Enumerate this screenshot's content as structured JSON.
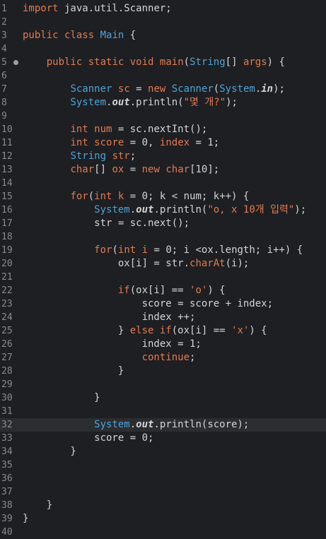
{
  "editor": {
    "language": "java",
    "current_line": 32,
    "lines": [
      {
        "n": "1",
        "tokens": [
          [
            "import",
            "kw"
          ],
          [
            " java.util.Scanner;",
            ""
          ]
        ]
      },
      {
        "n": "2",
        "tokens": []
      },
      {
        "n": "3",
        "tokens": [
          [
            "public",
            "kw"
          ],
          [
            " ",
            ""
          ],
          [
            "class",
            "kw"
          ],
          [
            " ",
            ""
          ],
          [
            "Main",
            "ty"
          ],
          [
            " {",
            ""
          ]
        ]
      },
      {
        "n": "4",
        "tokens": []
      },
      {
        "n": "5",
        "marker": true,
        "tokens": [
          [
            "    ",
            ""
          ],
          [
            "public",
            "kw"
          ],
          [
            " ",
            ""
          ],
          [
            "static",
            "kw"
          ],
          [
            " ",
            ""
          ],
          [
            "void",
            "kw"
          ],
          [
            " ",
            ""
          ],
          [
            "main",
            "kw"
          ],
          [
            "(",
            ""
          ],
          [
            "String",
            "ty"
          ],
          [
            "[] ",
            ""
          ],
          [
            "args",
            "kw"
          ],
          [
            ") {",
            ""
          ]
        ]
      },
      {
        "n": "6",
        "tokens": []
      },
      {
        "n": "7",
        "tokens": [
          [
            "        ",
            ""
          ],
          [
            "Scanner",
            "ty"
          ],
          [
            " ",
            ""
          ],
          [
            "sc",
            "kw"
          ],
          [
            " = ",
            ""
          ],
          [
            "new",
            "kw"
          ],
          [
            " ",
            ""
          ],
          [
            "Scanner",
            "ty"
          ],
          [
            "(",
            ""
          ],
          [
            "System",
            "ty"
          ],
          [
            ".",
            ""
          ],
          [
            "in",
            "sf"
          ],
          [
            ");",
            ""
          ]
        ]
      },
      {
        "n": "8",
        "tokens": [
          [
            "        ",
            ""
          ],
          [
            "System",
            "ty"
          ],
          [
            ".",
            ""
          ],
          [
            "out",
            "sf"
          ],
          [
            ".println(",
            ""
          ],
          [
            "\"몇 개?\"",
            "str"
          ],
          [
            ");",
            ""
          ]
        ]
      },
      {
        "n": "9",
        "tokens": []
      },
      {
        "n": "10",
        "tokens": [
          [
            "        ",
            ""
          ],
          [
            "int",
            "kw"
          ],
          [
            " ",
            ""
          ],
          [
            "num",
            "kw"
          ],
          [
            " = sc.nextInt();",
            ""
          ]
        ]
      },
      {
        "n": "11",
        "tokens": [
          [
            "        ",
            ""
          ],
          [
            "int",
            "kw"
          ],
          [
            " ",
            ""
          ],
          [
            "score",
            "kw"
          ],
          [
            " = 0, ",
            ""
          ],
          [
            "index",
            "kw"
          ],
          [
            " = 1;",
            ""
          ]
        ]
      },
      {
        "n": "12",
        "tokens": [
          [
            "        ",
            ""
          ],
          [
            "String",
            "ty"
          ],
          [
            " ",
            ""
          ],
          [
            "str",
            "kw"
          ],
          [
            ";",
            ""
          ]
        ]
      },
      {
        "n": "13",
        "tokens": [
          [
            "        ",
            ""
          ],
          [
            "char",
            "kw"
          ],
          [
            "[] ",
            ""
          ],
          [
            "ox",
            "kw"
          ],
          [
            " = ",
            ""
          ],
          [
            "new",
            "kw"
          ],
          [
            " ",
            ""
          ],
          [
            "char",
            "kw"
          ],
          [
            "[10];",
            ""
          ]
        ]
      },
      {
        "n": "14",
        "tokens": []
      },
      {
        "n": "15",
        "tokens": [
          [
            "        ",
            ""
          ],
          [
            "for",
            "kw"
          ],
          [
            "(",
            ""
          ],
          [
            "int",
            "kw"
          ],
          [
            " ",
            ""
          ],
          [
            "k",
            "kw"
          ],
          [
            " = 0; k < num; k++) {",
            ""
          ]
        ]
      },
      {
        "n": "16",
        "tokens": [
          [
            "            ",
            ""
          ],
          [
            "System",
            "ty"
          ],
          [
            ".",
            ""
          ],
          [
            "out",
            "sf"
          ],
          [
            ".println(",
            ""
          ],
          [
            "\"o, x 10개 입력\"",
            "str"
          ],
          [
            ");",
            ""
          ]
        ]
      },
      {
        "n": "17",
        "tokens": [
          [
            "            str = sc.next();",
            ""
          ]
        ]
      },
      {
        "n": "18",
        "tokens": []
      },
      {
        "n": "19",
        "tokens": [
          [
            "            ",
            ""
          ],
          [
            "for",
            "kw"
          ],
          [
            "(",
            ""
          ],
          [
            "int",
            "kw"
          ],
          [
            " ",
            ""
          ],
          [
            "i",
            "kw"
          ],
          [
            " = 0; i <ox.length; i++) {",
            ""
          ]
        ]
      },
      {
        "n": "20",
        "tokens": [
          [
            "                ox[i] = str.",
            ""
          ],
          [
            "charAt",
            "kw"
          ],
          [
            "(i);",
            ""
          ]
        ]
      },
      {
        "n": "21",
        "tokens": []
      },
      {
        "n": "22",
        "tokens": [
          [
            "                ",
            ""
          ],
          [
            "if",
            "kw"
          ],
          [
            "(ox[i] == ",
            ""
          ],
          [
            "'o'",
            "str"
          ],
          [
            ") {",
            ""
          ]
        ]
      },
      {
        "n": "23",
        "tokens": [
          [
            "                    score = score + index;",
            ""
          ]
        ]
      },
      {
        "n": "24",
        "tokens": [
          [
            "                    index ++;",
            ""
          ]
        ]
      },
      {
        "n": "25",
        "tokens": [
          [
            "                } ",
            ""
          ],
          [
            "else",
            "kw"
          ],
          [
            " ",
            ""
          ],
          [
            "if",
            "kw"
          ],
          [
            "(ox[i] == ",
            ""
          ],
          [
            "'x'",
            "str"
          ],
          [
            ") {",
            ""
          ]
        ]
      },
      {
        "n": "26",
        "tokens": [
          [
            "                    index = 1;",
            ""
          ]
        ]
      },
      {
        "n": "27",
        "tokens": [
          [
            "                    ",
            ""
          ],
          [
            "continue",
            "kw"
          ],
          [
            ";",
            ""
          ]
        ]
      },
      {
        "n": "28",
        "tokens": [
          [
            "                }",
            ""
          ]
        ]
      },
      {
        "n": "29",
        "tokens": []
      },
      {
        "n": "30",
        "tokens": [
          [
            "            }",
            ""
          ]
        ]
      },
      {
        "n": "31",
        "tokens": []
      },
      {
        "n": "32",
        "tokens": [
          [
            "            ",
            ""
          ],
          [
            "System",
            "ty"
          ],
          [
            ".",
            ""
          ],
          [
            "out",
            "sf"
          ],
          [
            ".println(score);",
            ""
          ]
        ]
      },
      {
        "n": "33",
        "tokens": [
          [
            "            score = 0;",
            ""
          ]
        ]
      },
      {
        "n": "34",
        "tokens": [
          [
            "        }",
            ""
          ]
        ]
      },
      {
        "n": "35",
        "tokens": []
      },
      {
        "n": "36",
        "tokens": []
      },
      {
        "n": "37",
        "tokens": []
      },
      {
        "n": "38",
        "tokens": [
          [
            "    }",
            ""
          ]
        ]
      },
      {
        "n": "39",
        "tokens": [
          [
            "}",
            ""
          ]
        ]
      },
      {
        "n": "40",
        "tokens": []
      }
    ]
  }
}
